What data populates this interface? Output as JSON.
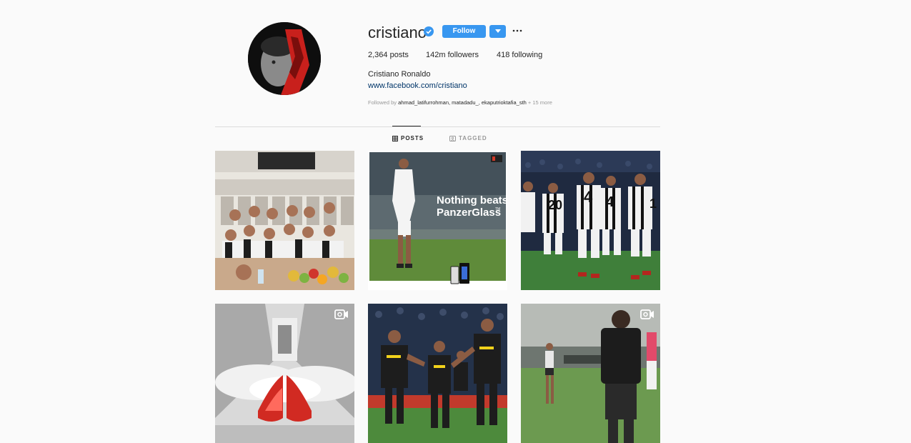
{
  "profile": {
    "username": "cristiano",
    "verified": true,
    "follow_label": "Follow",
    "full_name": "Cristiano Ronaldo",
    "website": "www.facebook.com/cristiano",
    "stats": {
      "posts": "2,364 posts",
      "followers": "142m followers",
      "following": "418 following"
    },
    "followed_by": {
      "prefix": "Followed by",
      "names": "ahmad_latifurrohman, matadadu_, ekaputrioktafia_sth",
      "more": "+ 15 more"
    }
  },
  "tabs": {
    "posts": "POSTS",
    "tagged": "TAGGED",
    "active": "posts"
  },
  "posts": [
    {
      "kind": "image",
      "scene": "locker-room-team-photo"
    },
    {
      "kind": "image",
      "scene": "panzerglass-ad",
      "headline_1": "Nothing beats",
      "headline_2": "PanzerGlass",
      "trademark": "TM"
    },
    {
      "kind": "image",
      "scene": "team-celebration-white-kits",
      "jersey_numbers": [
        "20",
        "4",
        "4",
        "1"
      ]
    },
    {
      "kind": "video",
      "scene": "red-boots-tunnel"
    },
    {
      "kind": "image",
      "scene": "match-celebration-black-kits"
    },
    {
      "kind": "video",
      "scene": "training-pitch"
    }
  ],
  "colors": {
    "accent": "#3897f0",
    "link": "#003569",
    "muted": "#999999",
    "text": "#262626",
    "background": "#fafafa",
    "divider": "#dbdbdb"
  },
  "icons": {
    "verified": "verified-badge-icon",
    "dropdown": "chevron-down-icon",
    "more": "more-dots-icon",
    "posts_tab": "grid-icon",
    "tagged_tab": "tag-icon",
    "video": "video-camera-icon"
  }
}
